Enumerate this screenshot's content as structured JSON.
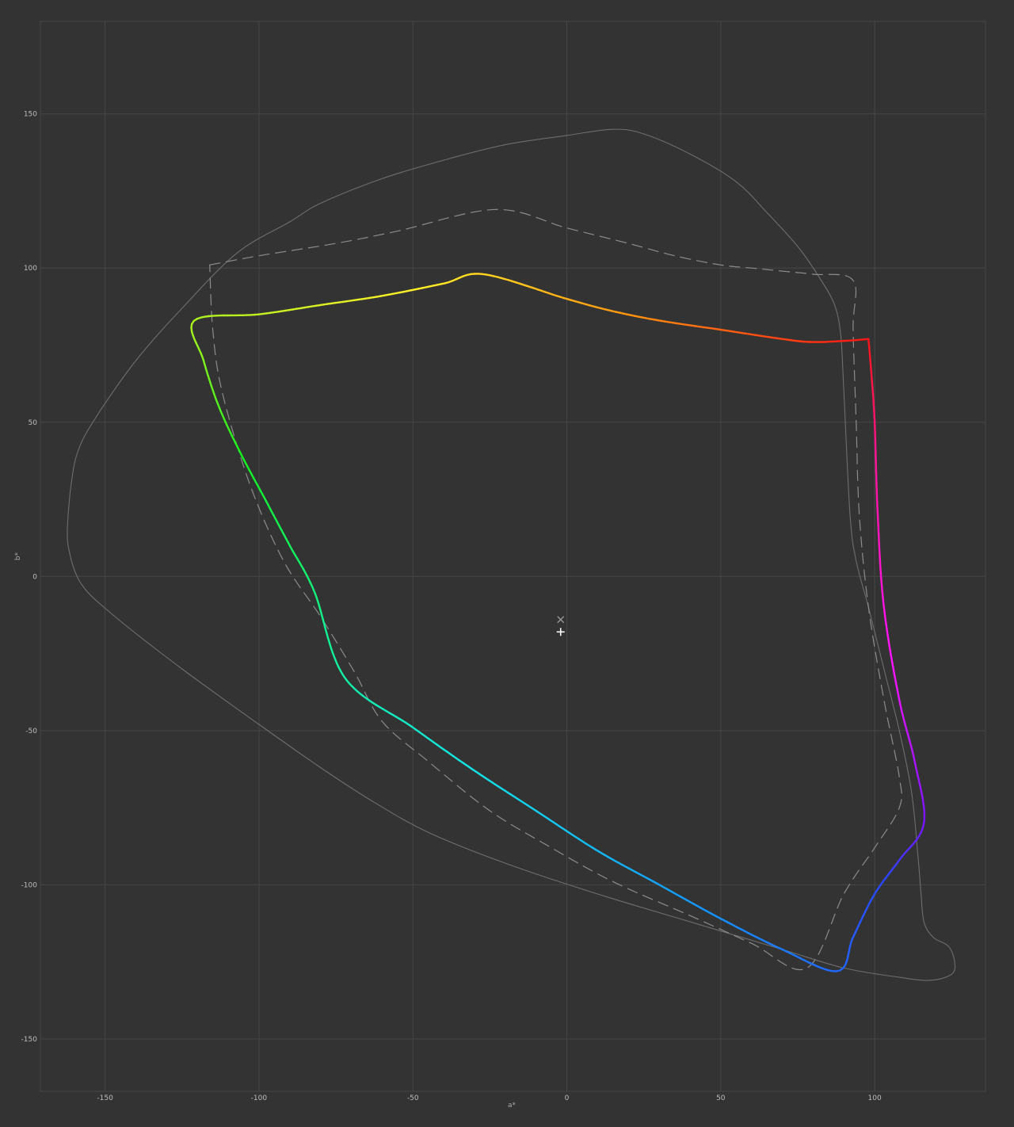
{
  "chart_data": {
    "type": "line",
    "title": "",
    "xlabel": "a*",
    "ylabel": "b*",
    "xlim": [
      -171,
      136
    ],
    "ylim": [
      -167,
      180
    ],
    "xticks": [
      -150,
      -100,
      -50,
      0,
      50,
      100
    ],
    "yticks": [
      150,
      100,
      50,
      0,
      -50,
      -100,
      -150
    ],
    "xtick_labels": [
      "-150",
      "-100",
      "-50",
      "0",
      "50",
      "100"
    ],
    "ytick_labels": [
      "150",
      "100",
      "50",
      "0",
      "-50",
      "-100",
      "-150"
    ],
    "grid": true,
    "colors": {
      "background": "#333333",
      "grid": "#464646",
      "outline": "#6e6e6e",
      "reference": "#8c8c8c",
      "marker": "#ffffff"
    },
    "series": [
      {
        "style": "solid-gray",
        "closed": true,
        "points": [
          [
            -162,
            20
          ],
          [
            -161,
            30
          ],
          [
            -159,
            40
          ],
          [
            -154,
            50
          ],
          [
            -140,
            70
          ],
          [
            -124,
            88
          ],
          [
            -107,
            105
          ],
          [
            -90,
            115
          ],
          [
            -80,
            121
          ],
          [
            -60,
            129
          ],
          [
            -40,
            135
          ],
          [
            -20,
            140
          ],
          [
            0,
            143
          ],
          [
            15,
            145
          ],
          [
            25,
            143.5
          ],
          [
            40,
            137
          ],
          [
            55,
            128
          ],
          [
            65,
            118
          ],
          [
            75,
            107
          ],
          [
            82,
            97
          ],
          [
            87,
            88
          ],
          [
            89,
            78
          ],
          [
            90,
            60
          ],
          [
            92,
            20
          ],
          [
            94,
            5
          ],
          [
            98,
            -10
          ],
          [
            103,
            -30
          ],
          [
            108,
            -50
          ],
          [
            112,
            -70
          ],
          [
            114,
            -90
          ],
          [
            115,
            -102
          ],
          [
            116,
            -112
          ],
          [
            119,
            -117
          ],
          [
            124,
            -120
          ],
          [
            126,
            -125
          ],
          [
            125,
            -129
          ],
          [
            118,
            -131
          ],
          [
            108,
            -130
          ],
          [
            90,
            -127
          ],
          [
            70,
            -121
          ],
          [
            40,
            -112
          ],
          [
            10,
            -103
          ],
          [
            -20,
            -93
          ],
          [
            -45,
            -83
          ],
          [
            -63,
            -73
          ],
          [
            -80,
            -62
          ],
          [
            -100,
            -48
          ],
          [
            -125,
            -30
          ],
          [
            -148,
            -12
          ],
          [
            -158,
            -2
          ],
          [
            -162,
            10
          ],
          [
            -162,
            20
          ]
        ]
      },
      {
        "style": "dashed-gray",
        "closed": true,
        "points": [
          [
            -116,
            101
          ],
          [
            -100,
            104
          ],
          [
            -75,
            108
          ],
          [
            -55,
            112
          ],
          [
            -23,
            119
          ],
          [
            0,
            113
          ],
          [
            20,
            108
          ],
          [
            35,
            104
          ],
          [
            50,
            101
          ],
          [
            60,
            100
          ],
          [
            70,
            99
          ],
          [
            80,
            98
          ],
          [
            93,
            96
          ],
          [
            93,
            80
          ],
          [
            94,
            50
          ],
          [
            95,
            20
          ],
          [
            98,
            -10
          ],
          [
            103,
            -40
          ],
          [
            108,
            -65
          ],
          [
            108,
            -75
          ],
          [
            100,
            -88
          ],
          [
            90,
            -103
          ],
          [
            78,
            -127
          ],
          [
            60,
            -119
          ],
          [
            40,
            -110
          ],
          [
            15,
            -99
          ],
          [
            -5,
            -88
          ],
          [
            -25,
            -76
          ],
          [
            -45,
            -60
          ],
          [
            -60,
            -47
          ],
          [
            -69,
            -31
          ],
          [
            -80,
            -13
          ],
          [
            -92,
            5
          ],
          [
            -103,
            30
          ],
          [
            -112,
            60
          ],
          [
            -115,
            80
          ],
          [
            -116,
            101
          ]
        ]
      },
      {
        "style": "gradient-gamut",
        "closed": true,
        "points": [
          [
            98,
            77
          ],
          [
            92,
            76.5
          ],
          [
            80,
            76
          ],
          [
            70,
            77
          ],
          [
            50,
            80
          ],
          [
            30,
            83
          ],
          [
            15,
            86
          ],
          [
            0,
            90
          ],
          [
            -27,
            98
          ],
          [
            -40,
            95
          ],
          [
            -60,
            91
          ],
          [
            -80,
            88
          ],
          [
            -100,
            85
          ],
          [
            -121,
            83
          ],
          [
            -118,
            70
          ],
          [
            -113,
            55
          ],
          [
            -106,
            40
          ],
          [
            -98,
            25
          ],
          [
            -90,
            10
          ],
          [
            -82,
            -5
          ],
          [
            -72,
            -33
          ],
          [
            -50,
            -49
          ],
          [
            -30,
            -63
          ],
          [
            -10,
            -76
          ],
          [
            10,
            -89
          ],
          [
            30,
            -100
          ],
          [
            50,
            -111
          ],
          [
            70,
            -121
          ],
          [
            88,
            -128
          ],
          [
            93,
            -117
          ],
          [
            100,
            -103
          ],
          [
            108,
            -92
          ],
          [
            116,
            -80
          ],
          [
            113,
            -60
          ],
          [
            108,
            -40
          ],
          [
            103,
            -10
          ],
          [
            101,
            20
          ],
          [
            100,
            50
          ],
          [
            99,
            65
          ],
          [
            98,
            77
          ]
        ],
        "gradient_stops": [
          {
            "t": 0.0,
            "color": "#ff1515"
          },
          {
            "t": 0.11,
            "color": "#ff9a10"
          },
          {
            "t": 0.2,
            "color": "#fff028"
          },
          {
            "t": 0.3,
            "color": "#a8f01e"
          },
          {
            "t": 0.36,
            "color": "#14f01e"
          },
          {
            "t": 0.44,
            "color": "#14f08c"
          },
          {
            "t": 0.53,
            "color": "#14e6e6"
          },
          {
            "t": 0.65,
            "color": "#1496ff"
          },
          {
            "t": 0.76,
            "color": "#2a46ff"
          },
          {
            "t": 0.79,
            "color": "#7814ff"
          },
          {
            "t": 0.86,
            "color": "#ff14ff"
          },
          {
            "t": 0.95,
            "color": "#ff1496"
          },
          {
            "t": 1.0,
            "color": "#ff1515"
          }
        ]
      }
    ],
    "markers": [
      {
        "shape": "x",
        "x": -2,
        "y": -14,
        "color": "#9a9a9a"
      },
      {
        "shape": "plus",
        "x": -2,
        "y": -18,
        "color": "#ffffff"
      }
    ]
  }
}
